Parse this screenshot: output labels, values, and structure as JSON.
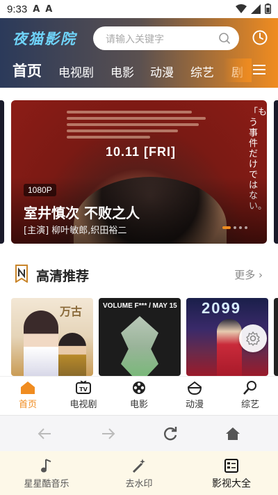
{
  "status_bar": {
    "time": "9:33",
    "notif_1": "A",
    "notif_2": "A"
  },
  "header": {
    "logo": "夜猫影院",
    "search_placeholder": "请输入关键字",
    "tabs": [
      "首页",
      "电视剧",
      "电影",
      "动漫",
      "综艺",
      "剧"
    ]
  },
  "banner": {
    "quality": "1080P",
    "title": "室井慎次 不败之人",
    "cast": "[主演] 柳叶敏郎,织田裕二",
    "date": "10.11 [FRI]",
    "vertical_text": "「もう事件だけではない。"
  },
  "section": {
    "title": "高清推荐",
    "more": "更多"
  },
  "posters": {
    "p1_caption": "万古",
    "p2_caption": "VOLUME F*** / MAY 15",
    "p3_caption": "2099"
  },
  "bottom_nav": [
    "首页",
    "电视剧",
    "电影",
    "动漫",
    "综艺"
  ],
  "dock": [
    "星星酷音乐",
    "去水印",
    "影视大全"
  ],
  "colors": {
    "accent": "#f08c20",
    "logo": "#6fd3f8",
    "header_start": "#2b3a5a",
    "header_end": "#f08c20"
  },
  "icons": {
    "status": [
      "wifi-icon",
      "signal-icon",
      "battery-icon"
    ],
    "header": [
      "search-icon",
      "history-icon",
      "menu-icon"
    ],
    "bottom_nav": [
      "home-icon",
      "tv-icon",
      "film-reel-icon",
      "anime-icon",
      "microphone-icon"
    ],
    "browser": [
      "back-icon",
      "forward-icon",
      "reload-icon",
      "browser-home-icon"
    ],
    "dock": [
      "music-note-icon",
      "magic-wand-icon",
      "video-list-icon"
    ]
  }
}
